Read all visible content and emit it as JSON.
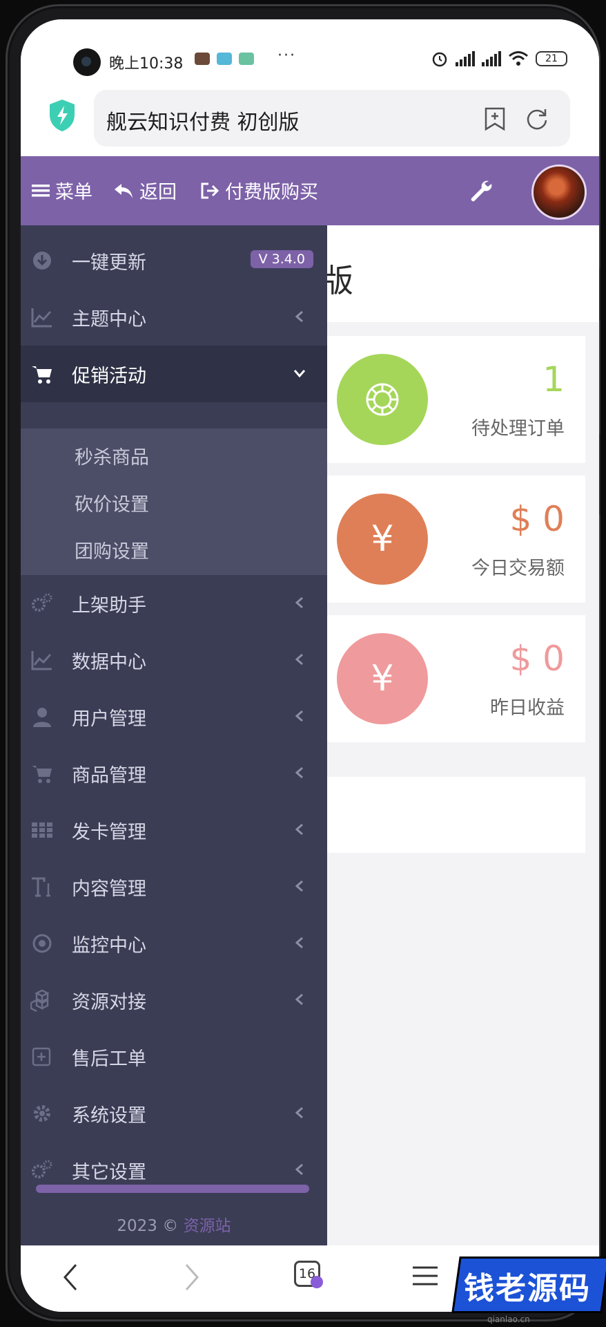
{
  "status_bar": {
    "time": "晚上10:38",
    "dots": "···",
    "battery": "21"
  },
  "browser": {
    "page_title": "舰云知识付费 初创版",
    "tab_count": "16"
  },
  "navbar": {
    "menu_label": "菜单",
    "back_label": "返回",
    "buy_label": "付费版购买"
  },
  "main": {
    "title_fragment": "版",
    "stats": [
      {
        "value": "1",
        "label": "待处理订单",
        "color": "#a5d65a",
        "circle": "#a5d65a"
      },
      {
        "value": "$ 0",
        "label": "今日交易额",
        "color": "#df7f57",
        "circle": "#df7f57"
      },
      {
        "value": "$ 0",
        "label": "昨日收益",
        "color": "#ef9a9c",
        "circle": "#ef9a9c"
      }
    ],
    "yen_symbol": "¥"
  },
  "sidebar": {
    "items": [
      {
        "label": "一键更新",
        "icon": "download-circle-icon",
        "badge": "V 3.4.0"
      },
      {
        "label": "主题中心",
        "icon": "line-chart-icon"
      },
      {
        "label": "促销活动",
        "icon": "cart-icon",
        "expanded": true
      },
      {
        "label": "上架助手",
        "icon": "gears-icon"
      },
      {
        "label": "数据中心",
        "icon": "line-chart-icon"
      },
      {
        "label": "用户管理",
        "icon": "user-icon"
      },
      {
        "label": "商品管理",
        "icon": "cart-icon"
      },
      {
        "label": "发卡管理",
        "icon": "grid-icon"
      },
      {
        "label": "内容管理",
        "icon": "text-icon"
      },
      {
        "label": "监控中心",
        "icon": "target-icon"
      },
      {
        "label": "资源对接",
        "icon": "cubes-icon"
      },
      {
        "label": "售后工单",
        "icon": "plus-square-icon"
      },
      {
        "label": "系统设置",
        "icon": "gear-icon"
      },
      {
        "label": "其它设置",
        "icon": "gears-icon"
      }
    ],
    "submenu": [
      "秒杀商品",
      "砍价设置",
      "团购设置"
    ],
    "footer_year": "2023 ©",
    "footer_link": "资源站"
  },
  "watermark": {
    "text": "钱老源码",
    "domain": "qianlao.cn"
  },
  "colors": {
    "accent": "#7d62a8",
    "sidebar": "#3b3d55",
    "sidebar_active": "#2f3146"
  }
}
